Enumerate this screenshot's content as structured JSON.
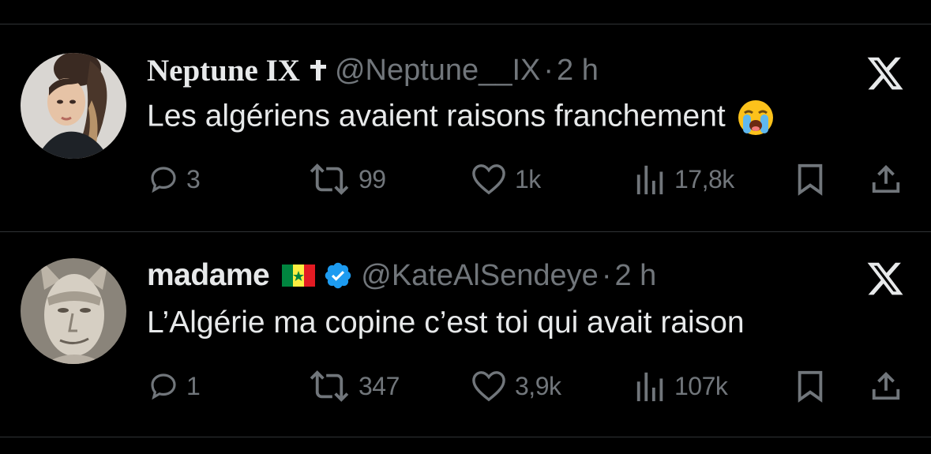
{
  "tweets": [
    {
      "author_name": "Neptune IX",
      "name_suffix_icon": "cross-icon",
      "handle": "@Neptune__IX",
      "separator": "·",
      "time": "2 h",
      "text": "Les algériens avaient raisons franchement",
      "emoji_icon": "loudly-crying-face-emoji",
      "stats": {
        "replies": "3",
        "retweets": "99",
        "likes": "1k",
        "views": "17,8k"
      }
    },
    {
      "author_name": "madame",
      "flag_icon": "senegal-flag-icon",
      "verified_icon": "verified-badge-icon",
      "handle": "@KateAlSendeye",
      "separator": "·",
      "time": "2 h",
      "text": "L’Algérie ma copine c’est toi qui avait raison",
      "stats": {
        "replies": "1",
        "retweets": "347",
        "likes": "3,9k",
        "views": "107k"
      }
    }
  ],
  "colors": {
    "background": "#000000",
    "text_primary": "#e7e9ea",
    "text_secondary": "#71767b",
    "divider": "#2f3336",
    "verified_blue": "#1d9bf0"
  }
}
